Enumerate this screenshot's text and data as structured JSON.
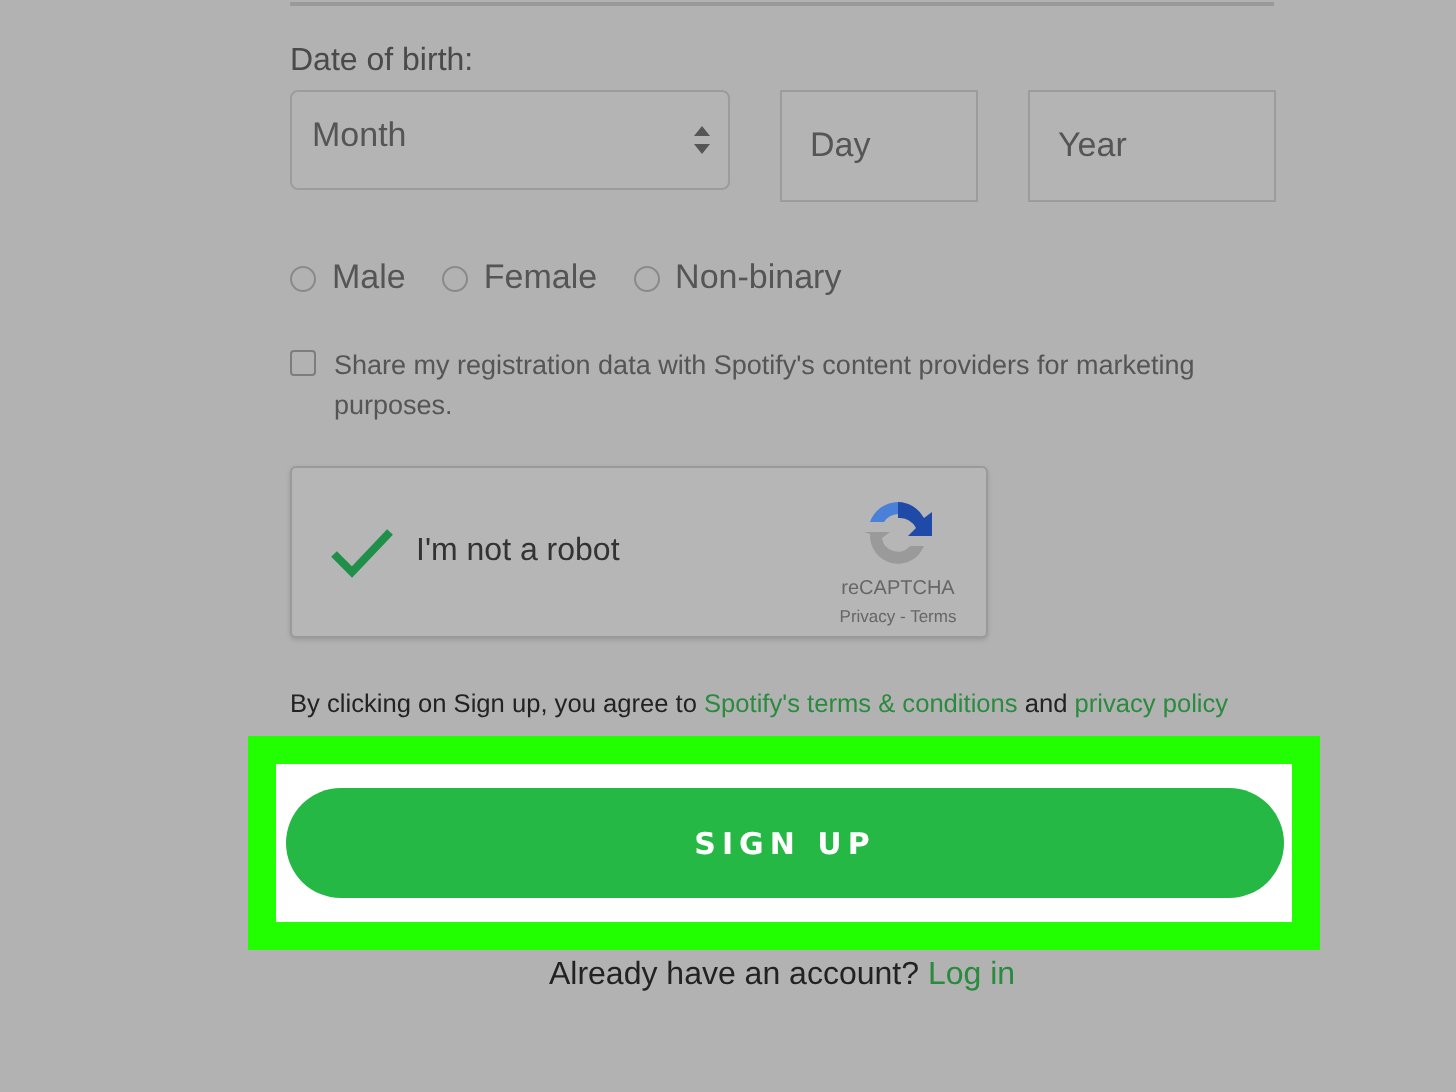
{
  "date_of_birth": {
    "label": "Date of birth:",
    "month": {
      "placeholder": "Month"
    },
    "day": {
      "placeholder": "Day"
    },
    "year": {
      "placeholder": "Year"
    }
  },
  "gender": [
    {
      "label": "Male",
      "selected": false
    },
    {
      "label": "Female",
      "selected": false
    },
    {
      "label": "Non-binary",
      "selected": false
    }
  ],
  "share_data": {
    "label": "Share my registration data with Spotify's content providers for marketing purposes.",
    "checked": false
  },
  "recaptcha": {
    "label": "I'm not a robot",
    "checked": true,
    "brand": "reCAPTCHA",
    "links": "Privacy - Terms"
  },
  "terms": [
    {
      "kind": "text",
      "text": "By clicking on Sign up, you agree to "
    },
    {
      "kind": "link",
      "text": "Spotify's terms & conditions"
    },
    {
      "kind": "text",
      "text": " and "
    },
    {
      "kind": "link",
      "text": "privacy policy"
    }
  ],
  "sign_up_button": "SIGN UP",
  "login_prompt": {
    "text": "Already have an account?",
    "link": "Log in"
  }
}
